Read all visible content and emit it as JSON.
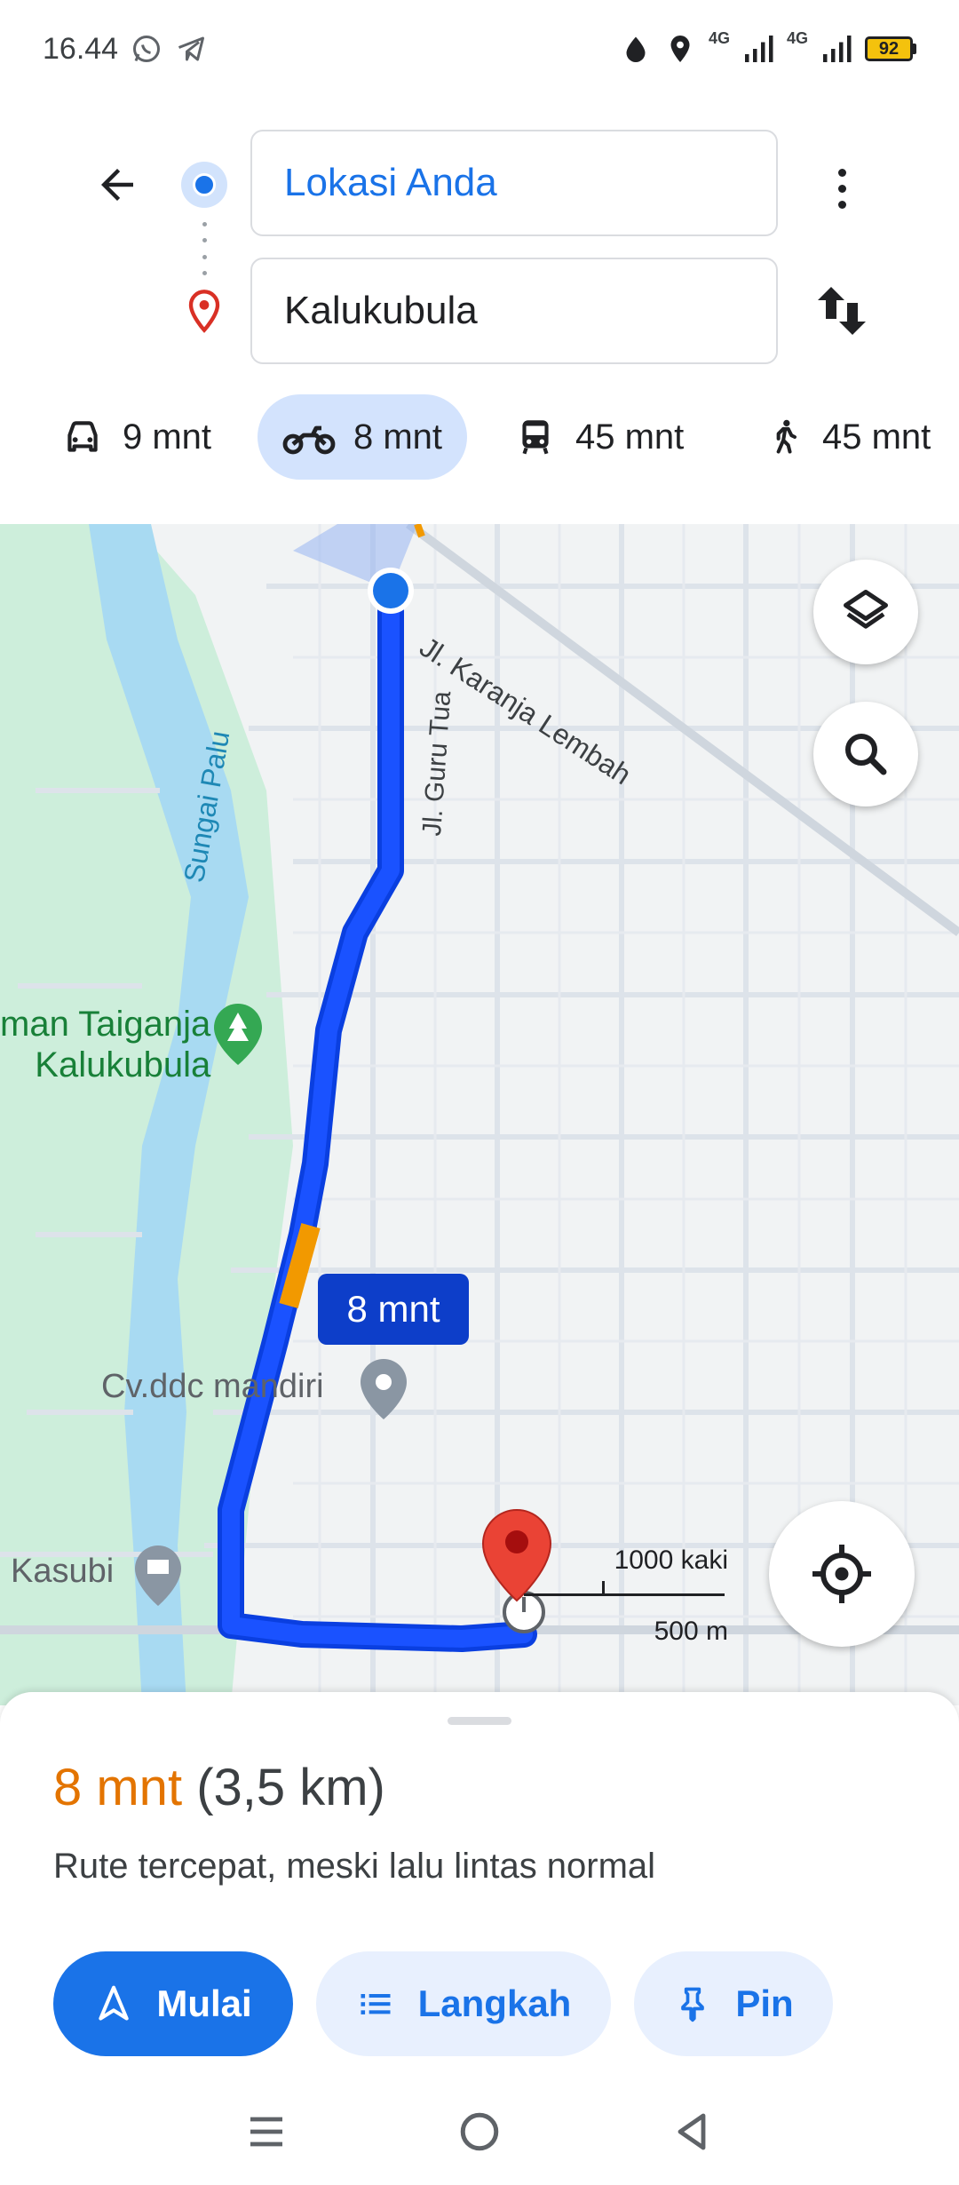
{
  "status_bar": {
    "time": "16.44",
    "network_1": "4G",
    "network_2": "4G",
    "battery": "92",
    "icons": [
      "whatsapp-icon",
      "telegram-icon",
      "data-saver-icon",
      "location-icon",
      "signal-icon",
      "signal-icon"
    ]
  },
  "directions": {
    "origin": "Lokasi Anda",
    "destination": "Kalukubula"
  },
  "modes": [
    {
      "icon": "car-icon",
      "label": "9 mnt"
    },
    {
      "icon": "motorcycle-icon",
      "label": "8 mnt",
      "selected": true
    },
    {
      "icon": "transit-icon",
      "label": "45 mnt"
    },
    {
      "icon": "walk-icon",
      "label": "45 mnt"
    }
  ],
  "map": {
    "labels": {
      "street_1": "Jl. Karanja Lembah",
      "street_2": "Jl. Guru Tua",
      "river": "Sungai Palu",
      "park": "man Taiganja\nKalukubula",
      "business": "Cv.ddc mandiri",
      "place": "Kasubi"
    },
    "route_eta": "8 mnt",
    "scale": {
      "imperial": "1000 kaki",
      "metric": "500 m"
    },
    "colors": {
      "route": "#1a3df0",
      "traffic": "#f29900",
      "water": "#aadaff",
      "park": "#c8f0d8",
      "pin": "#ea4335"
    }
  },
  "summary": {
    "duration": "8 mnt",
    "distance": "(3,5 km)",
    "description": "Rute tercepat, meski lalu lintas normal"
  },
  "actions": {
    "start": "Mulai",
    "steps": "Langkah",
    "pin": "Pin"
  },
  "nav_bar": [
    "menu-icon",
    "home-icon",
    "back-icon"
  ]
}
